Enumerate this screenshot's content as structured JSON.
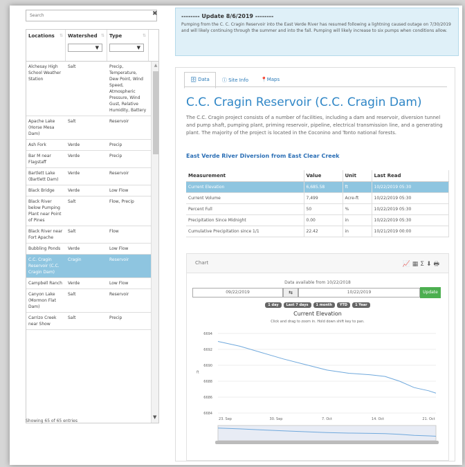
{
  "search": {
    "placeholder": "Search"
  },
  "grid": {
    "headers": [
      "Locations",
      "Watershed",
      "Type"
    ],
    "filter_value": "▼",
    "rows": [
      {
        "loc": "Alchesay High School Weather Station",
        "ws": "Salt",
        "type": "Precip, Temperature, Dew Point, Wind Speed, Atmospheric Pressure, Wind Gust, Relative Humidity, Battery",
        "sel": false
      },
      {
        "loc": "Apache Lake (Horse Mesa Dam)",
        "ws": "Salt",
        "type": "Reservoir",
        "sel": false
      },
      {
        "loc": "Ash Fork",
        "ws": "Verde",
        "type": "Precip",
        "sel": false
      },
      {
        "loc": "Bar M near Flagstaff",
        "ws": "Verde",
        "type": "Precip",
        "sel": false
      },
      {
        "loc": "Bartlett Lake (Bartlett Dam)",
        "ws": "Verde",
        "type": "Reservoir",
        "sel": false
      },
      {
        "loc": "Black Bridge",
        "ws": "Verde",
        "type": "Low Flow",
        "sel": false
      },
      {
        "loc": "Black River below Pumping Plant near Point of Pines",
        "ws": "Salt",
        "type": "Flow, Precip",
        "sel": false
      },
      {
        "loc": "Black River near Fort Apache",
        "ws": "Salt",
        "type": "Flow",
        "sel": false
      },
      {
        "loc": "Bubbling Ponds",
        "ws": "Verde",
        "type": "Low Flow",
        "sel": false
      },
      {
        "loc": "C.C. Cragin Reservoir (C.C. Cragin Dam)",
        "ws": "Cragin",
        "type": "Reservoir",
        "sel": true
      },
      {
        "loc": "Campbell Ranch",
        "ws": "Verde",
        "type": "Low Flow",
        "sel": false
      },
      {
        "loc": "Canyon Lake (Mormon Flat Dam)",
        "ws": "Salt",
        "type": "Reservoir",
        "sel": false
      },
      {
        "loc": "Carrizo Creek near Show",
        "ws": "Salt",
        "type": "Precip",
        "sel": false
      }
    ],
    "footer": "Showing 65 of 65 entries"
  },
  "alert": {
    "title": "-------- Update 8/6/2019 --------",
    "body": "Pumping from the C. C. Cragin Reservoir into the East Verde River has resumed following a lightning caused outage on 7/30/2019 and will likely continuing through the summer and into the fall. Pumping will likely increase to six pumps when conditions allow."
  },
  "tabs": [
    {
      "label": "Data",
      "icon": "database-icon"
    },
    {
      "label": "Site Info",
      "icon": "info-icon"
    },
    {
      "label": "Maps",
      "icon": "map-marker-icon"
    }
  ],
  "site": {
    "title": "C.C. Cragin Reservoir (C.C. Cragin Dam)",
    "description": "The C.C. Cragin project consists of a number of facilities, including a dam and reservoir, diversion tunnel and pump shaft, pumping plant, priming reservoir, pipeline, electrical transmission line, and a generating plant. The majority of the project is located in the Coconino and Tonto national forests.",
    "link": "East Verde River Diversion from East Clear Creek"
  },
  "measurements": {
    "headers": [
      "Measurement",
      "Value",
      "Unit",
      "Last Read"
    ],
    "rows": [
      {
        "m": "Current Elevation",
        "v": "6,685.58",
        "u": "ft",
        "d": "10/22/2019 05:30",
        "sel": true
      },
      {
        "m": "Current Volume",
        "v": "7,499",
        "u": "Acre-ft",
        "d": "10/22/2019 05:30",
        "sel": false
      },
      {
        "m": "Percent Full",
        "v": "50",
        "u": "%",
        "d": "10/22/2019 05:30",
        "sel": false
      },
      {
        "m": "Precipitation Since Midnight",
        "v": "0.00",
        "u": "in",
        "d": "10/22/2019 05:30",
        "sel": false
      },
      {
        "m": "Cumulative Precipitation since 1/1",
        "v": "22.42",
        "u": "in",
        "d": "10/21/2019 00:00",
        "sel": false
      }
    ]
  },
  "chart_panel": {
    "label": "Chart",
    "available": "Data available from 10/22/2018",
    "start": "09/22/2019",
    "arrow": "⇆",
    "end": "10/22/2019",
    "update": "Update",
    "ranges": [
      "1 day",
      "Last 7 days",
      "1 month",
      "YTD",
      "1 Year"
    ]
  },
  "chart_data": {
    "type": "line",
    "title": "Current Elevation",
    "subtitle": "Click and drag to zoom in. Hold down shift key to pan.",
    "ylabel": "ft",
    "y_ticks": [
      "6694",
      "6692",
      "6690",
      "6688",
      "6686",
      "6684"
    ],
    "x_ticks": [
      "23. Sep",
      "30. Sep",
      "7. Oct",
      "14. Oct",
      "21. Oct"
    ],
    "ylim": [
      6684,
      6694
    ],
    "series": [
      {
        "values": [
          [
            0,
            6693.0
          ],
          [
            3,
            6692.4
          ],
          [
            6,
            6691.6
          ],
          [
            9,
            6690.8
          ],
          [
            12,
            6690.1
          ],
          [
            15,
            6689.4
          ],
          [
            18,
            6689.0
          ],
          [
            21,
            6688.8
          ],
          [
            23,
            6688.6
          ],
          [
            25,
            6688.0
          ],
          [
            27,
            6687.2
          ],
          [
            29,
            6686.8
          ],
          [
            30,
            6686.5
          ]
        ]
      }
    ],
    "line_color": "#6fa8dc"
  }
}
